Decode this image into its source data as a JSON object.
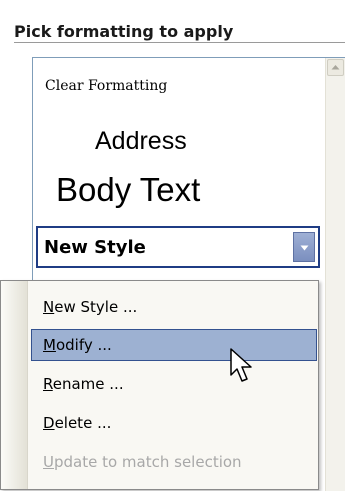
{
  "panel": {
    "heading": "Pick formatting to apply"
  },
  "style_list": {
    "clear_formatting": "Clear Formatting",
    "address": "Address",
    "body_text": "Body Text",
    "selected_style": "New Style"
  },
  "context_menu": {
    "items": [
      {
        "label": "New Style ...",
        "mnemonic": "N",
        "state": "normal"
      },
      {
        "label": "Modify ...",
        "mnemonic": "M",
        "state": "hover"
      },
      {
        "label": "Rename ...",
        "mnemonic": "R",
        "state": "normal"
      },
      {
        "label": "Delete ...",
        "mnemonic": "D",
        "state": "normal"
      },
      {
        "label": "Update to match selection",
        "mnemonic": "U",
        "state": "disabled"
      }
    ]
  },
  "icons": {
    "scroll_up": "scroll-up-arrow-icon",
    "dropdown": "chevron-down-icon",
    "cursor": "mouse-pointer-icon"
  },
  "colors": {
    "selection_border": "#1f3c84",
    "menu_hover": "#9db1d2",
    "menu_hover_border": "#34528f",
    "disabled_text": "#a8a8a8"
  }
}
